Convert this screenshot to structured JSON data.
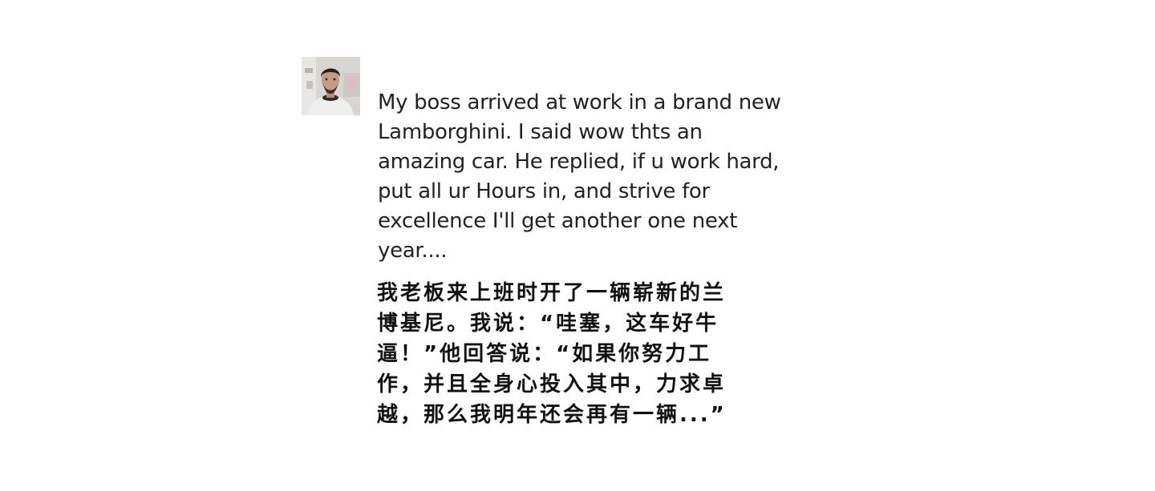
{
  "post": {
    "avatar_icon": "user-avatar-photo",
    "text": "My boss arrived at work in a brand new\nLamborghini. I said wow thts an\namazing car. He replied, if u work hard,\nput all ur Hours in, and strive for\nexcellence I'll get another one next\nyear....",
    "translation": "我老板来上班时开了一辆崭新的兰\n博基尼。我说：“哇塞，这车好牛\n逼！”他回答说：“如果你努力工\n作，并且全身心投入其中，力求卓\n越，那么我明年还会再有一辆...”"
  }
}
